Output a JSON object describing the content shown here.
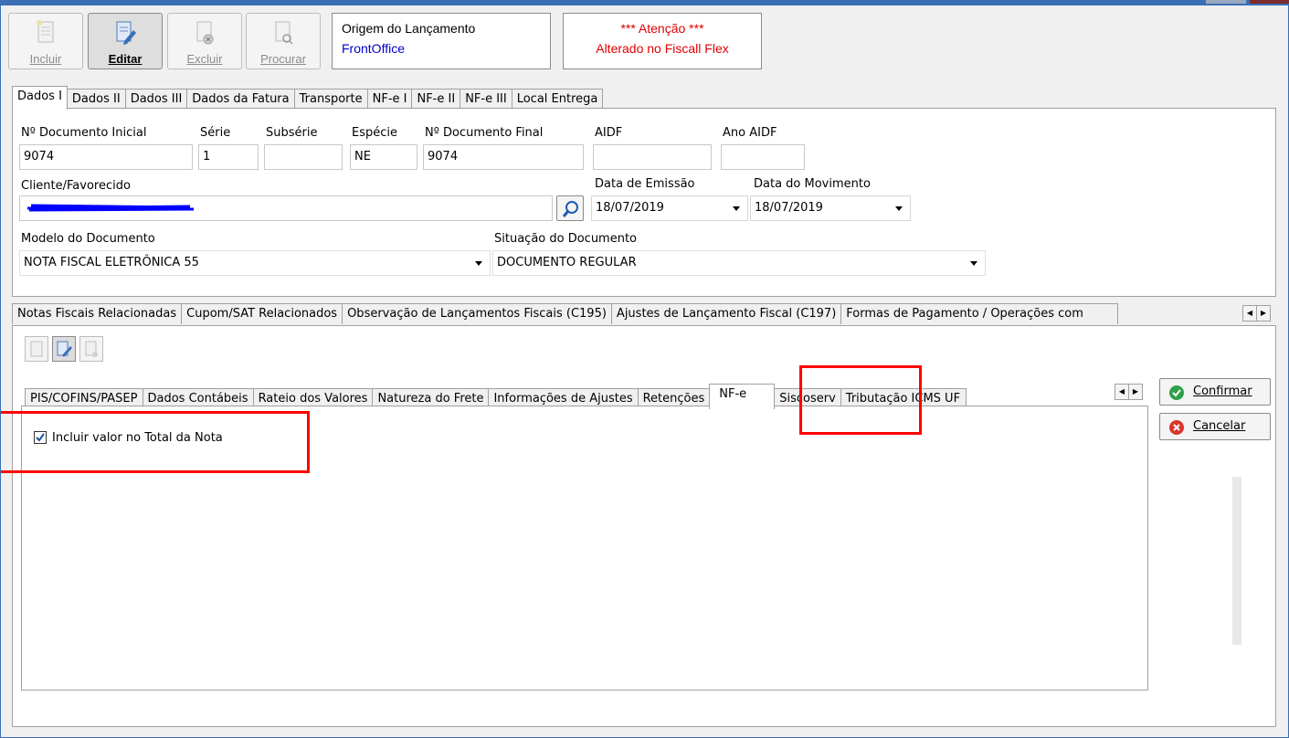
{
  "toolbar": {
    "incluir": "Incluir",
    "editar": "Editar",
    "excluir": "Excluir",
    "procurar": "Procurar"
  },
  "origem": {
    "label": "Origem do Lançamento",
    "value": "FrontOffice"
  },
  "atencao": {
    "line1": "*** Atenção ***",
    "line2": "Alterado no Fiscall Flex"
  },
  "main_tabs": [
    "Dados I",
    "Dados II",
    "Dados III",
    "Dados da Fatura",
    "Transporte",
    "NF-e I",
    "NF-e II",
    "NF-e III",
    "Local Entrega"
  ],
  "form": {
    "doc_inicial_label": "Nº Documento Inicial",
    "doc_inicial_value": "9074",
    "serie_label": "Série",
    "serie_value": "1",
    "subserie_label": "Subsérie",
    "subserie_value": "",
    "especie_label": "Espécie",
    "especie_value": "NE",
    "doc_final_label": "Nº Documento Final",
    "doc_final_value": "9074",
    "aidf_label": "AIDF",
    "aidf_value": "",
    "ano_aidf_label": "Ano AIDF",
    "ano_aidf_value": "",
    "cliente_label": "Cliente/Favorecido",
    "data_emissao_label": "Data de Emissão",
    "data_emissao_value": "18/07/2019",
    "data_movimento_label": "Data do Movimento",
    "data_movimento_value": "18/07/2019",
    "modelo_label": "Modelo do Documento",
    "modelo_value": "NOTA FISCAL ELETRÔNICA 55",
    "situacao_label": "Situação do Documento",
    "situacao_value": "DOCUMENTO REGULAR"
  },
  "sub_tabs": [
    "Notas Fiscais Relacionadas",
    "Cupom/SAT Relacionados",
    "Observação de Lançamentos Fiscais (C195)",
    "Ajustes de Lançamento Fiscal (C197)",
    "Formas de Pagamento / Operações com"
  ],
  "inner_tabs": [
    "PIS/COFINS/PASEP",
    "Dados Contábeis",
    "Rateio dos Valores",
    "Natureza do Frete",
    "Informações de Ajustes",
    "Retenções",
    "NF-e",
    "Siscoserv",
    "Tributação ICMS UF"
  ],
  "checkbox": {
    "label": "Incluir valor no Total da Nota",
    "checked": true
  },
  "buttons": {
    "confirmar": "Confirmar",
    "cancelar": "Cancelar"
  },
  "colors": {
    "accent": "#3b6fb5",
    "alert": "#e00000",
    "link": "#0000cc",
    "highlight": "#ff0000"
  }
}
